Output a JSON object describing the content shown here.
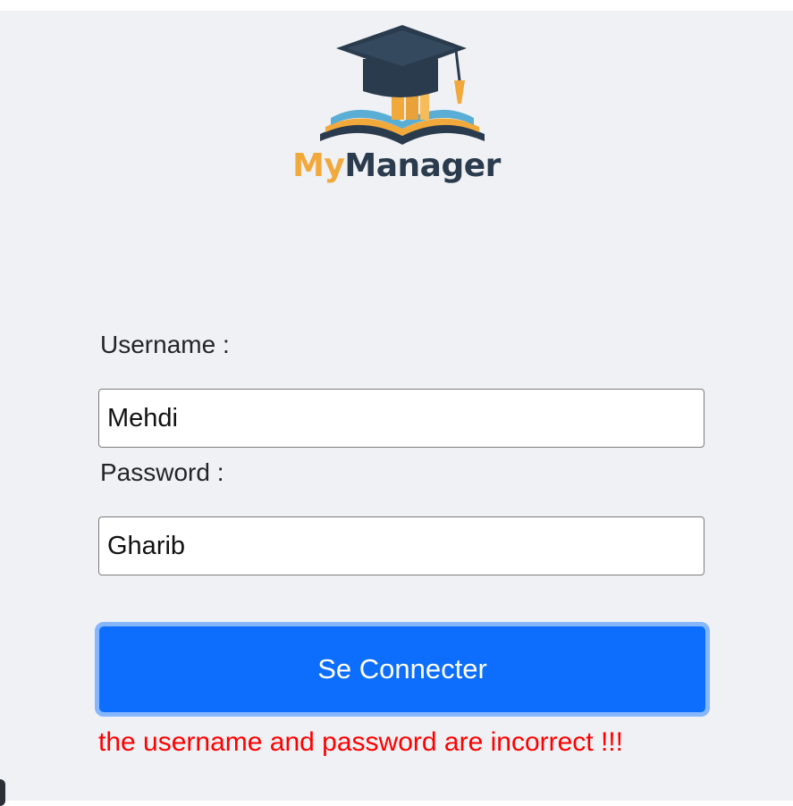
{
  "brand": {
    "prefix": "My",
    "suffix": "Manager",
    "prefix_color": "#f2a93b",
    "suffix_color": "#2a3b4d",
    "logo_icon": "graduation-cap-book-icon"
  },
  "form": {
    "username_label": "Username :",
    "username_value": "Mehdi",
    "password_label": "Password :",
    "password_value": "Gharib",
    "submit_label": "Se Connecter",
    "error_message": "the username and password are incorrect !!!"
  },
  "colors": {
    "background": "#f0f1f4",
    "button": "#0d6efd",
    "button_focus_ring": "#86b7fe",
    "error": "#ff0000"
  }
}
